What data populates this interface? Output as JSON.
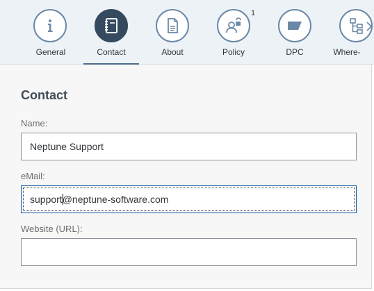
{
  "tabs": [
    {
      "key": "general",
      "label": "General",
      "icon": "info-icon",
      "selected": false,
      "badge": ""
    },
    {
      "key": "contact",
      "label": "Contact",
      "icon": "notebook-icon",
      "selected": true,
      "badge": ""
    },
    {
      "key": "about",
      "label": "About",
      "icon": "document-icon",
      "selected": false,
      "badge": ""
    },
    {
      "key": "policy",
      "label": "Policy",
      "icon": "user-unlock-icon",
      "selected": false,
      "badge": "1"
    },
    {
      "key": "dpc",
      "label": "DPC",
      "icon": "card-icon",
      "selected": false,
      "badge": ""
    },
    {
      "key": "where",
      "label": "Where-",
      "icon": "hierarchy-icon",
      "selected": false,
      "badge": ""
    }
  ],
  "form": {
    "title": "Contact",
    "name_label": "Name:",
    "name_value": "Neptune Support",
    "email_label": "eMail:",
    "email_value_before_caret": "support",
    "email_value_after_caret": "@neptune-software.com",
    "website_label": "Website (URL):",
    "website_value": ""
  },
  "colors": {
    "icon_stroke": "#6b88a6",
    "selected_fill": "#354a5f",
    "tabbar_bg": "#edf2f7",
    "panel_bg": "#f7f7f7"
  }
}
